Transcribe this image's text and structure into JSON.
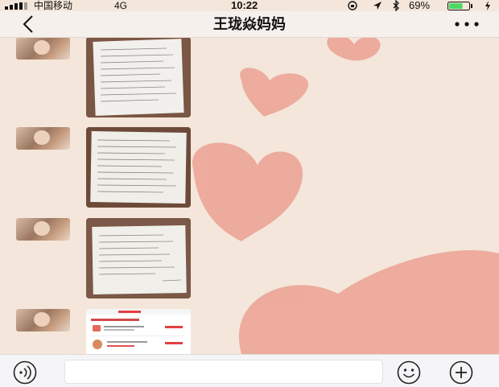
{
  "status_bar": {
    "carrier": "中国移动",
    "network": "4G",
    "time": "10:22",
    "battery": "69%",
    "battery_level": 0.69,
    "icons": [
      "signal-icon",
      "lock-rotation-icon",
      "location-icon",
      "bluetooth-icon",
      "battery-icon",
      "charging-icon"
    ]
  },
  "nav": {
    "title": "王珑焱妈妈",
    "back_icon": "back-chevron-icon",
    "more_icon": "more-icon"
  },
  "messages": [
    {
      "type": "image",
      "content": "handwritten-worksheet-photo"
    },
    {
      "type": "image",
      "content": "handwritten-worksheet-photo"
    },
    {
      "type": "image",
      "content": "handwritten-worksheet-photo"
    },
    {
      "type": "image",
      "content": "app-screenshot-photo"
    }
  ],
  "input_bar": {
    "icons": [
      "voice-icon",
      "emoji-icon",
      "plus-icon"
    ]
  },
  "colors": {
    "chat_bg": "#f3e4d8",
    "heart": "#eba193",
    "battery_fill": "#4cd964"
  }
}
